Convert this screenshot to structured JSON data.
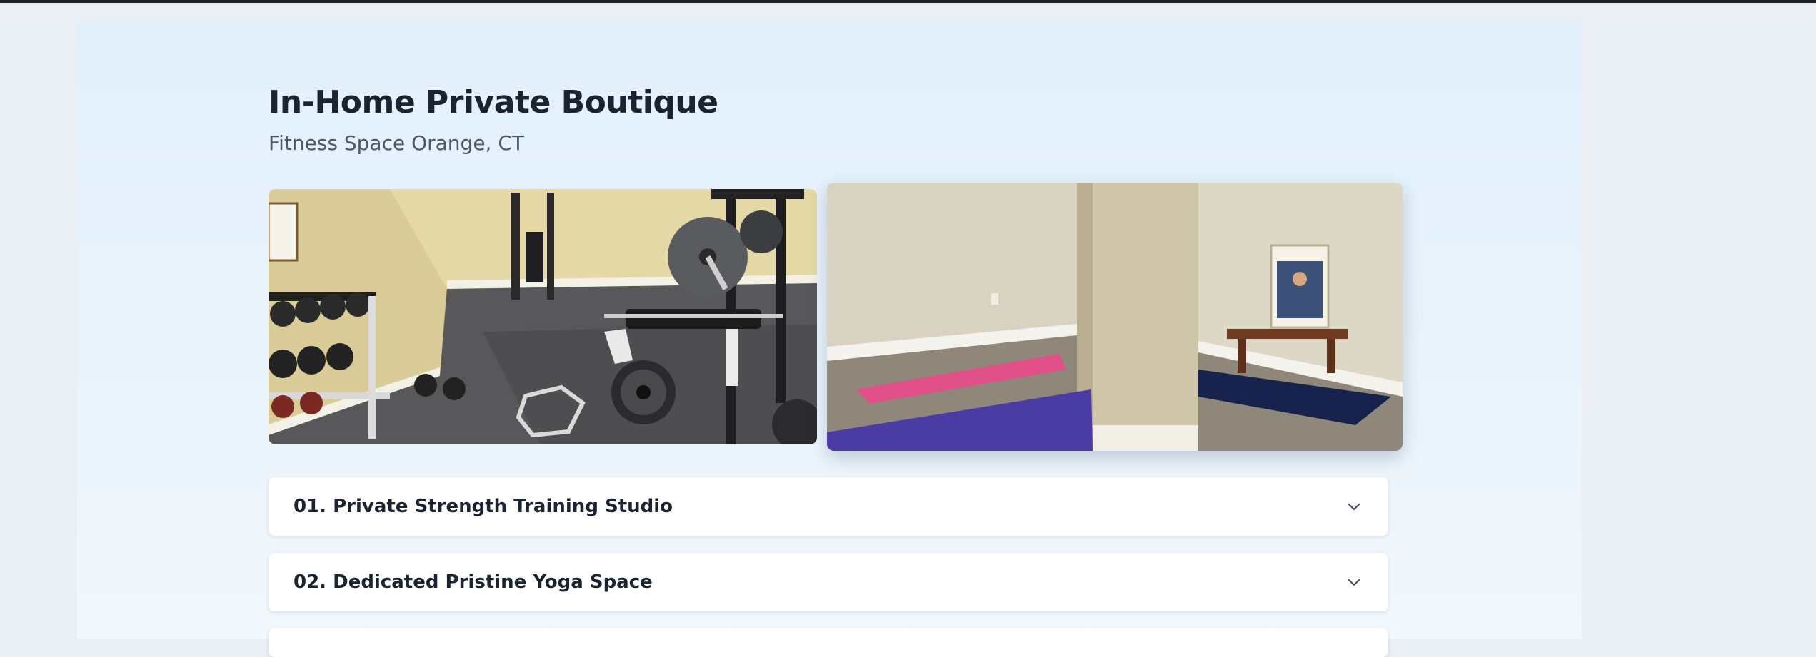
{
  "header": {
    "title": "In-Home Private Boutique",
    "subtitle": "Fitness Space Orange, CT"
  },
  "gallery": {
    "images": [
      {
        "subject": "home gym with dumbbell rack, weight bench and barbell plates"
      },
      {
        "subject": "basement yoga space with mats, bench and framed poster"
      }
    ]
  },
  "accordion": {
    "items": [
      {
        "label": "01. Private Strength Training Studio",
        "icon": "chevron-down-icon"
      },
      {
        "label": "02. Dedicated Pristine Yoga Space",
        "icon": "chevron-down-icon"
      },
      {
        "label": "",
        "icon": "chevron-down-icon"
      }
    ]
  },
  "colors": {
    "title": "#1b2230",
    "subtitle": "#4e5866",
    "panel_background": "#e2effb",
    "page_background": "#e9eff3"
  }
}
